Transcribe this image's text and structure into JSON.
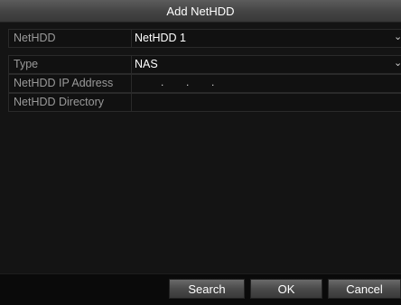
{
  "dialog": {
    "title": "Add NetHDD"
  },
  "fields": {
    "nethdd": {
      "label": "NetHDD",
      "value": "NetHDD 1"
    },
    "type": {
      "label": "Type",
      "value": "NAS"
    },
    "ip_address": {
      "label": "NetHDD IP Address",
      "value": ""
    },
    "directory": {
      "label": "NetHDD Directory",
      "value": ""
    }
  },
  "buttons": {
    "search": "Search",
    "ok": "OK",
    "cancel": "Cancel"
  },
  "icons": {
    "dropdown": "chevron-down-icon"
  }
}
